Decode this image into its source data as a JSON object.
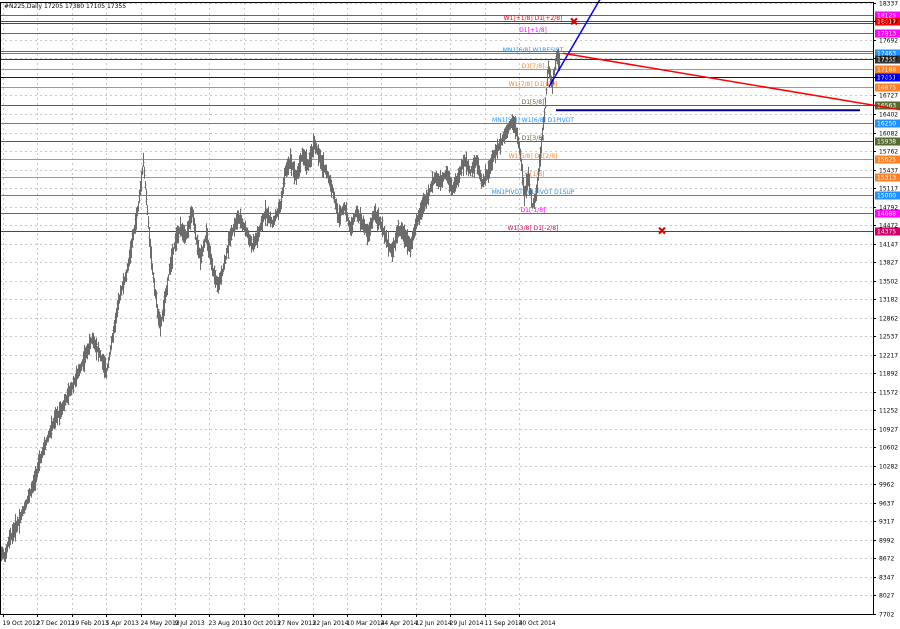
{
  "chart_data": {
    "type": "ohlc",
    "header": "#N225,Daily  17205 17380 17105 17355",
    "grid": true,
    "ylim": [
      7702,
      18337
    ],
    "y_ticks": [
      7702,
      8027,
      8347,
      8672,
      8992,
      9317,
      9637,
      9962,
      10282,
      10602,
      10927,
      11252,
      11572,
      11892,
      12217,
      12537,
      12862,
      13182,
      13502,
      13827,
      14147,
      14472,
      14792,
      15117,
      15437,
      15762,
      16082,
      16402,
      16727,
      17052,
      17372,
      17692,
      18017,
      18337
    ],
    "x_ticks": [
      "19 Oct 2012",
      "27 Dec 2012",
      "19 Feb 2013",
      "5 Apr 2013",
      "24 May 2013",
      "9 Jul 2013",
      "23 Aug 2013",
      "10 Oct 2013",
      "27 Nov 2013",
      "22 Jan 2014",
      "10 Mar 2014",
      "24 Apr 2014",
      "12 Jun 2014",
      "29 Jul 2014",
      "11 Sep 2014",
      "30 Oct 2014"
    ],
    "price_series": [
      [
        0,
        8800
      ],
      [
        5,
        8700
      ],
      [
        8,
        8950
      ],
      [
        12,
        9100
      ],
      [
        18,
        9300
      ],
      [
        25,
        9600
      ],
      [
        32,
        9900
      ],
      [
        40,
        10400
      ],
      [
        48,
        10800
      ],
      [
        55,
        11100
      ],
      [
        62,
        11300
      ],
      [
        70,
        11600
      ],
      [
        78,
        11900
      ],
      [
        85,
        12200
      ],
      [
        92,
        12500
      ],
      [
        100,
        12200
      ],
      [
        106,
        11900
      ],
      [
        110,
        12300
      ],
      [
        115,
        12800
      ],
      [
        120,
        13300
      ],
      [
        126,
        13600
      ],
      [
        132,
        14200
      ],
      [
        138,
        14800
      ],
      [
        143,
        15600
      ],
      [
        148,
        14500
      ],
      [
        152,
        13700
      ],
      [
        157,
        13000
      ],
      [
        160,
        12700
      ],
      [
        165,
        13200
      ],
      [
        170,
        13800
      ],
      [
        175,
        14200
      ],
      [
        180,
        14400
      ],
      [
        186,
        14300
      ],
      [
        192,
        14700
      ],
      [
        196,
        14200
      ],
      [
        200,
        13900
      ],
      [
        206,
        14300
      ],
      [
        212,
        13700
      ],
      [
        218,
        13400
      ],
      [
        224,
        13800
      ],
      [
        230,
        14300
      ],
      [
        238,
        14600
      ],
      [
        245,
        14400
      ],
      [
        252,
        14100
      ],
      [
        258,
        14300
      ],
      [
        265,
        14700
      ],
      [
        272,
        14500
      ],
      [
        280,
        14800
      ],
      [
        285,
        15400
      ],
      [
        290,
        15600
      ],
      [
        296,
        15300
      ],
      [
        302,
        15700
      ],
      [
        308,
        15500
      ],
      [
        314,
        15900
      ],
      [
        320,
        15600
      ],
      [
        326,
        15400
      ],
      [
        332,
        15100
      ],
      [
        338,
        14600
      ],
      [
        344,
        14800
      ],
      [
        350,
        14400
      ],
      [
        356,
        14700
      ],
      [
        362,
        14500
      ],
      [
        368,
        14300
      ],
      [
        374,
        14700
      ],
      [
        380,
        14500
      ],
      [
        386,
        14200
      ],
      [
        392,
        14000
      ],
      [
        398,
        14400
      ],
      [
        404,
        14300
      ],
      [
        410,
        14100
      ],
      [
        416,
        14500
      ],
      [
        422,
        14800
      ],
      [
        428,
        15000
      ],
      [
        434,
        15300
      ],
      [
        440,
        15200
      ],
      [
        446,
        15400
      ],
      [
        452,
        15100
      ],
      [
        458,
        15300
      ],
      [
        464,
        15600
      ],
      [
        470,
        15400
      ],
      [
        476,
        15600
      ],
      [
        482,
        15200
      ],
      [
        488,
        15400
      ],
      [
        494,
        15700
      ],
      [
        500,
        15900
      ],
      [
        506,
        16100
      ],
      [
        512,
        16300
      ],
      [
        516,
        16100
      ],
      [
        520,
        15700
      ],
      [
        524,
        15000
      ],
      [
        528,
        15300
      ],
      [
        532,
        14800
      ],
      [
        536,
        15000
      ],
      [
        540,
        15700
      ],
      [
        544,
        16400
      ],
      [
        548,
        17200
      ],
      [
        552,
        16900
      ],
      [
        556,
        17400
      ],
      [
        560,
        17350
      ]
    ],
    "levels": [
      {
        "price": 18125,
        "color": "#ff00ff",
        "tag": "18125",
        "label": ""
      },
      {
        "price": 18017,
        "color": "#ff0000",
        "tag": "18017",
        "label": "W1[+1/8] D1[+2/8]"
      },
      {
        "price": 17990,
        "color": "#ff0000",
        "tag": "",
        "label": ""
      },
      {
        "price": 17813,
        "color": "#ff00ff",
        "tag": "17813",
        "label": "D1[+1/8]"
      },
      {
        "price": 17500,
        "color": "#ff00ff",
        "tag": "",
        "label": ""
      },
      {
        "price": 17463,
        "color": "#1e90ff",
        "tag": "17463",
        "label": "MN1[6/8] W1RESIST"
      },
      {
        "price": 17355,
        "color": "#333333",
        "tag": "17355",
        "label": ""
      },
      {
        "price": 17188,
        "color": "#ff7f27",
        "tag": "17188",
        "label": "D1[7/8]"
      },
      {
        "price": 17051,
        "color": "#0000ff",
        "tag": "17051",
        "label": ""
      },
      {
        "price": 16875,
        "color": "#ff7f27",
        "tag": "16875",
        "label": "W1[7/8] D1[6/8]"
      },
      {
        "price": 16563,
        "color": "#556b2f",
        "tag": "16563",
        "label": "D1[5/8]"
      },
      {
        "price": 16250,
        "color": "#1e90ff",
        "tag": "16250",
        "label": "MN1[5/8] W1[6/8] D1PIVOT"
      },
      {
        "price": 15938,
        "color": "#556b2f",
        "tag": "15938",
        "label": "D1[3/8]"
      },
      {
        "price": 15625,
        "color": "#ff7f27",
        "tag": "15625",
        "label": "W1[5/8] D1[2/8]"
      },
      {
        "price": 15313,
        "color": "#ff7f27",
        "tag": "15313",
        "label": "D1[1/8]"
      },
      {
        "price": 15000,
        "color": "#1e90ff",
        "tag": "15000",
        "label": "MN1PIVOT W1PIVOT D1SUP"
      },
      {
        "price": 14688,
        "color": "#ff00ff",
        "tag": "14688",
        "label": "D1[-1/8]"
      },
      {
        "price": 14375,
        "color": "#cc0066",
        "tag": "14375",
        "label": "W1[3/8] D1[-2/8]"
      }
    ],
    "trendlines": [
      {
        "color": "#0000ff",
        "width": 1.5,
        "x1": 549,
        "y1": 16880,
        "x2": 600,
        "y2": 18400
      },
      {
        "color": "#ff0000",
        "width": 1.5,
        "x1": 563,
        "y1": 17463,
        "x2": 900,
        "y2": 16480
      },
      {
        "color": "#00008b",
        "width": 2,
        "x1": 556,
        "y1": 16470,
        "x2": 860,
        "y2": 16470
      }
    ],
    "markers": [
      {
        "type": "x",
        "color": "#dd0000",
        "x": 574,
        "price": 18017
      },
      {
        "type": "x",
        "color": "#dd0000",
        "x": 662,
        "price": 14375
      }
    ]
  }
}
